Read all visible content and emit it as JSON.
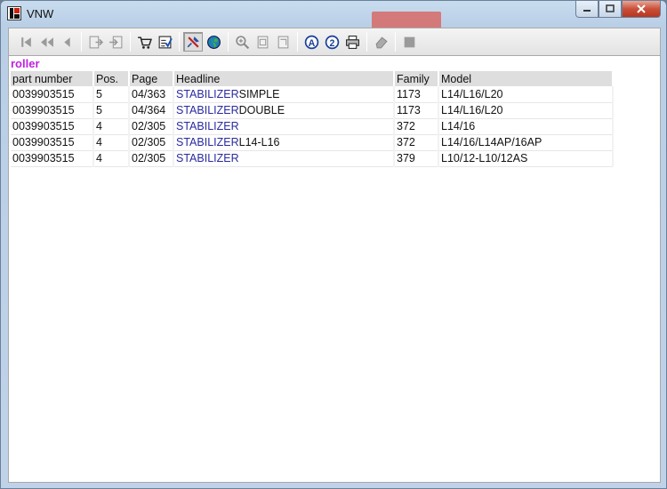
{
  "window": {
    "title": "VNW"
  },
  "toolbar": {
    "buttons": [
      {
        "name": "first-record-icon"
      },
      {
        "name": "previous-page-icon"
      },
      {
        "name": "previous-record-icon"
      },
      {
        "name": "export-icon"
      },
      {
        "name": "import-icon"
      },
      {
        "name": "cart-icon"
      },
      {
        "name": "checklist-icon"
      },
      {
        "name": "pin-icon"
      },
      {
        "name": "globe-icon"
      },
      {
        "name": "zoom-in-icon"
      },
      {
        "name": "page-icon"
      },
      {
        "name": "page-alt-icon"
      },
      {
        "name": "circle-a-icon"
      },
      {
        "name": "circle-2-icon"
      },
      {
        "name": "print-icon"
      },
      {
        "name": "eraser-icon"
      },
      {
        "name": "stop-icon"
      }
    ]
  },
  "search": {
    "term": "roller"
  },
  "table": {
    "headers": [
      "part number",
      "Pos.",
      "Page",
      "Headline",
      "Family",
      "Model"
    ],
    "rows": [
      {
        "part": "0039903515",
        "pos": "5",
        "page": "04/363",
        "headline_link": "STABILIZER",
        "headline_rest": "SIMPLE",
        "family": "1173",
        "model": "L14/L16/L20"
      },
      {
        "part": "0039903515",
        "pos": "5",
        "page": "04/364",
        "headline_link": "STABILIZER",
        "headline_rest": "DOUBLE",
        "family": "1173",
        "model": "L14/L16/L20"
      },
      {
        "part": "0039903515",
        "pos": "4",
        "page": "02/305",
        "headline_link": "STABILIZER",
        "headline_rest": "",
        "family": "372",
        "model": "L14/16"
      },
      {
        "part": "0039903515",
        "pos": "4",
        "page": "02/305",
        "headline_link": "STABILIZER",
        "headline_rest": "L14-L16",
        "family": "372",
        "model": "L14/16/L14AP/16AP"
      },
      {
        "part": "0039903515",
        "pos": "4",
        "page": "02/305",
        "headline_link": "STABILIZER",
        "headline_rest": "",
        "family": "379",
        "model": "L10/12-L10/12AS"
      }
    ]
  },
  "colors": {
    "search_term": "#c020e0",
    "link": "#2a2aa0",
    "close_button": "#c9503a"
  }
}
